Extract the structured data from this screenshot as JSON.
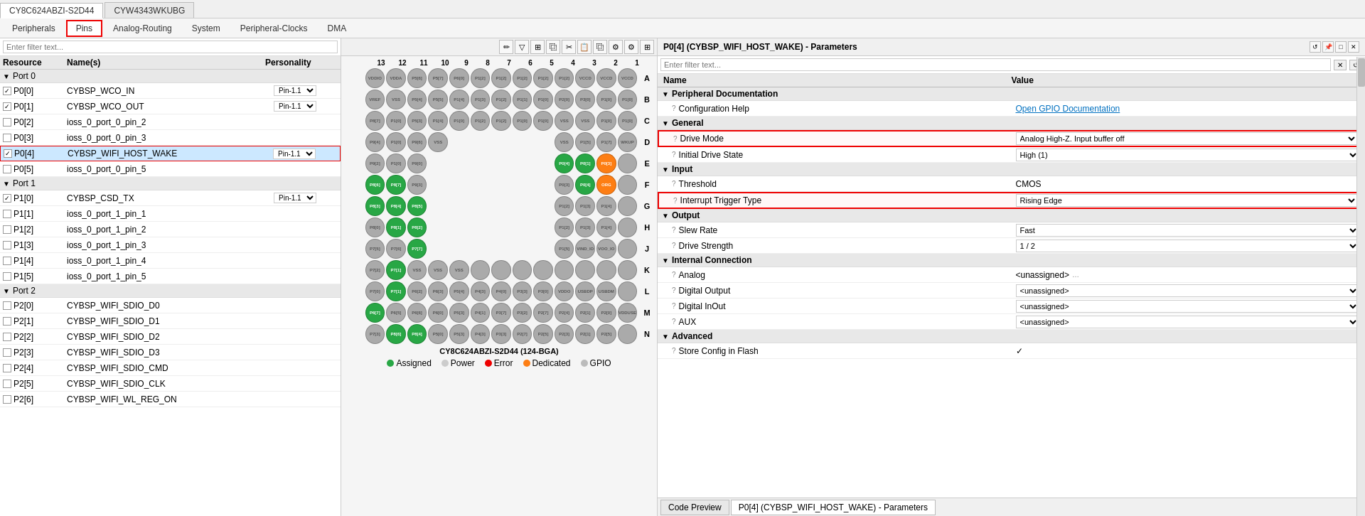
{
  "tabs": {
    "items": [
      {
        "label": "CY8C624ABZI-S2D44",
        "active": true,
        "redBorder": false
      },
      {
        "label": "CYW4343WKUBG",
        "active": false,
        "redBorder": false
      }
    ]
  },
  "nav": {
    "tabs": [
      {
        "label": "Peripherals",
        "active": false
      },
      {
        "label": "Pins",
        "active": true
      },
      {
        "label": "Analog-Routing",
        "active": false
      },
      {
        "label": "System",
        "active": false
      },
      {
        "label": "Peripheral-Clocks",
        "active": false
      },
      {
        "label": "DMA",
        "active": false
      }
    ]
  },
  "left": {
    "filter_placeholder": "Enter filter text...",
    "headers": [
      "Resource",
      "Name(s)",
      "Personality"
    ],
    "groups": [
      {
        "label": "Port 0",
        "rows": [
          {
            "resource": "P0[0]",
            "checked": true,
            "name": "CYBSP_WCO_IN",
            "personality": "Pin-1.1"
          },
          {
            "resource": "P0[1]",
            "checked": true,
            "name": "CYBSP_WCO_OUT",
            "personality": "Pin-1.1"
          },
          {
            "resource": "P0[2]",
            "checked": false,
            "name": "ioss_0_port_0_pin_2",
            "personality": ""
          },
          {
            "resource": "P0[3]",
            "checked": false,
            "name": "ioss_0_port_0_pin_3",
            "personality": ""
          },
          {
            "resource": "P0[4]",
            "checked": true,
            "name": "CYBSP_WIFI_HOST_WAKE",
            "personality": "Pin-1.1",
            "selected": true
          },
          {
            "resource": "P0[5]",
            "checked": false,
            "name": "ioss_0_port_0_pin_5",
            "personality": ""
          }
        ]
      },
      {
        "label": "Port 1",
        "rows": [
          {
            "resource": "P1[0]",
            "checked": true,
            "name": "CYBSP_CSD_TX",
            "personality": "Pin-1.1"
          },
          {
            "resource": "P1[1]",
            "checked": false,
            "name": "ioss_0_port_1_pin_1",
            "personality": ""
          },
          {
            "resource": "P1[2]",
            "checked": false,
            "name": "ioss_0_port_1_pin_2",
            "personality": ""
          },
          {
            "resource": "P1[3]",
            "checked": false,
            "name": "ioss_0_port_1_pin_3",
            "personality": ""
          },
          {
            "resource": "P1[4]",
            "checked": false,
            "name": "ioss_0_port_1_pin_4",
            "personality": ""
          },
          {
            "resource": "P1[5]",
            "checked": false,
            "name": "ioss_0_port_1_pin_5",
            "personality": ""
          }
        ]
      },
      {
        "label": "Port 2",
        "rows": [
          {
            "resource": "P2[0]",
            "checked": false,
            "name": "CYBSP_WIFI_SDIO_D0",
            "personality": ""
          },
          {
            "resource": "P2[1]",
            "checked": false,
            "name": "CYBSP_WIFI_SDIO_D1",
            "personality": ""
          },
          {
            "resource": "P2[2]",
            "checked": false,
            "name": "CYBSP_WIFI_SDIO_D2",
            "personality": ""
          },
          {
            "resource": "P2[3]",
            "checked": false,
            "name": "CYBSP_WIFI_SDIO_D3",
            "personality": ""
          },
          {
            "resource": "P2[4]",
            "checked": false,
            "name": "CYBSP_WIFI_SDIO_CMD",
            "personality": ""
          },
          {
            "resource": "P2[5]",
            "checked": false,
            "name": "CYBSP_WIFI_SDIO_CLK",
            "personality": ""
          },
          {
            "resource": "P2[6]",
            "checked": false,
            "name": "CYBSP_WIFI_WL_REG_ON",
            "personality": ""
          }
        ]
      }
    ]
  },
  "right": {
    "title": "P0[4] (CYBSP_WIFI_HOST_WAKE) - Parameters",
    "filter_placeholder": "Enter filter text...",
    "headers": {
      "name": "Name",
      "value": "Value"
    },
    "sections": [
      {
        "label": "Peripheral Documentation",
        "rows": [
          {
            "name": "Configuration Help",
            "value": "Open GPIO Documentation",
            "value_type": "link",
            "help": true
          }
        ]
      },
      {
        "label": "General",
        "rows": [
          {
            "name": "Drive Mode",
            "value": "Analog High-Z. Input buffer off",
            "value_type": "select",
            "help": true,
            "highlight": true
          },
          {
            "name": "Initial Drive State",
            "value": "High (1)",
            "value_type": "select",
            "help": true
          }
        ]
      },
      {
        "label": "Input",
        "rows": [
          {
            "name": "Threshold",
            "value": "CMOS",
            "value_type": "text",
            "help": true
          },
          {
            "name": "Interrupt Trigger Type",
            "value": "Rising Edge",
            "value_type": "select",
            "help": true,
            "highlight": true
          }
        ]
      },
      {
        "label": "Output",
        "rows": [
          {
            "name": "Slew Rate",
            "value": "Fast",
            "value_type": "select",
            "help": true
          },
          {
            "name": "Drive Strength",
            "value": "1 / 2",
            "value_type": "select",
            "help": true
          }
        ]
      },
      {
        "label": "Internal Connection",
        "rows": [
          {
            "name": "Analog",
            "value": "<unassigned>",
            "value_type": "text_ellipsis",
            "help": true
          },
          {
            "name": "Digital Output",
            "value": "<unassigned>",
            "value_type": "select",
            "help": true
          },
          {
            "name": "Digital InOut",
            "value": "<unassigned>",
            "value_type": "select",
            "help": true
          },
          {
            "name": "AUX",
            "value": "<unassigned>",
            "value_type": "select",
            "help": true
          }
        ]
      },
      {
        "label": "Advanced",
        "rows": [
          {
            "name": "Store Config in Flash",
            "value": "✓",
            "value_type": "check",
            "help": true
          }
        ]
      }
    ],
    "bottom_tabs": [
      {
        "label": "Code Preview",
        "active": false
      },
      {
        "label": "P0[4] (CYBSP_WIFI_HOST_WAKE) - Parameters",
        "active": true
      }
    ]
  },
  "chip": {
    "title": "CY8C624ABZI-S2D44 (124-BGA)",
    "col_labels": [
      "13",
      "12",
      "11",
      "10",
      "9",
      "8",
      "7",
      "6",
      "5",
      "4",
      "3",
      "2",
      "1"
    ],
    "row_labels": [
      "A",
      "B",
      "C",
      "D",
      "E",
      "F",
      "G",
      "H",
      "J",
      "K",
      "L",
      "M",
      "N"
    ],
    "legend": [
      {
        "color": "#28a745",
        "label": "Assigned"
      },
      {
        "color": "#ccc",
        "label": "Power"
      },
      {
        "color": "#e00",
        "label": "Error"
      },
      {
        "color": "#fd7e14",
        "label": "Dedicated"
      },
      {
        "color": "#bbb",
        "label": "GPIO"
      }
    ]
  },
  "icons": {
    "expand": "▼",
    "collapse": "▶",
    "help": "?",
    "filter": "▼",
    "clear": "✕",
    "restore": "↺",
    "pin": "📌",
    "maximize": "□",
    "close": "✕",
    "pencil": "✏",
    "dropdown": "▼"
  }
}
